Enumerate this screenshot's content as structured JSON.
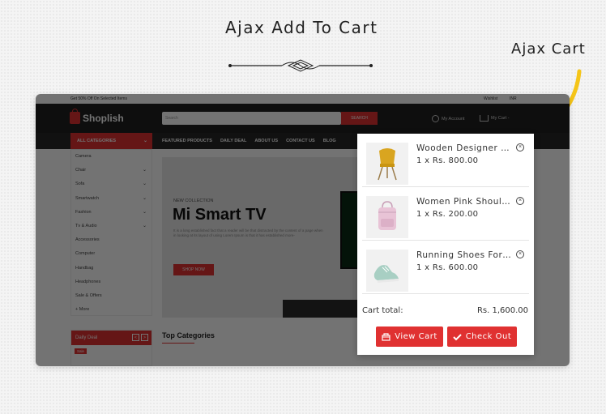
{
  "heading": "Ajax Add To Cart",
  "side_label": "Ajax Cart",
  "site": {
    "offer_text": "Get 50% Off On Selected Items",
    "wishlist": "Wishlist",
    "language": "INR",
    "logo": "Shoplish",
    "search_placeholder": "Search",
    "search_button": "SEARCH",
    "my_account": "My Account",
    "my_cart": "My Cart -",
    "all_categories": "ALL CATEGORIES",
    "nav": [
      "FEATURED PRODUCTS",
      "DAILY DEAL",
      "ABOUT US",
      "CONTACT US",
      "BLOG"
    ],
    "categories": [
      {
        "label": "Camera",
        "arrow": false
      },
      {
        "label": "Chair",
        "arrow": true
      },
      {
        "label": "Sofa",
        "arrow": true
      },
      {
        "label": "Smartwatch",
        "arrow": true
      },
      {
        "label": "Fashion",
        "arrow": true
      },
      {
        "label": "Tv & Audio",
        "arrow": true
      },
      {
        "label": "Accessories",
        "arrow": false
      },
      {
        "label": "Computer",
        "arrow": false
      },
      {
        "label": "Handbag",
        "arrow": false
      },
      {
        "label": "Headphones",
        "arrow": false
      },
      {
        "label": "Sale & Offers",
        "arrow": false
      },
      {
        "label": "+ More",
        "arrow": false
      }
    ],
    "banner": {
      "kicker": "NEW COLLECTION",
      "title": "Mi Smart TV",
      "description": "It is a long established fact that a reader will be that distracted by the content of a page when in looking at its layout of using Lorem Ipsum is that it has established more-",
      "button": "SHOP NOW"
    },
    "daily_deal": "Daily Deal",
    "deal_prev": "<",
    "deal_next": ">",
    "sale_badge": "Sale",
    "top_categories": "Top Categories"
  },
  "cart": {
    "items": [
      {
        "name": "Wooden Designer Lighting Chair",
        "qty_price": "1 x Rs. 800.00",
        "image": "yellow-chair"
      },
      {
        "name": "Women Pink Shoulder Bag",
        "qty_price": "1 x Rs. 200.00",
        "image": "pink-bag"
      },
      {
        "name": "Running Shoes For Men",
        "qty_price": "1 x Rs. 600.00",
        "image": "green-shoes"
      }
    ],
    "total_label": "Cart total:",
    "total_value": "Rs. 1,600.00",
    "view_cart": "View Cart",
    "check_out": "Check Out"
  },
  "colors": {
    "accent": "#e03131",
    "arrow": "#f5c518"
  }
}
